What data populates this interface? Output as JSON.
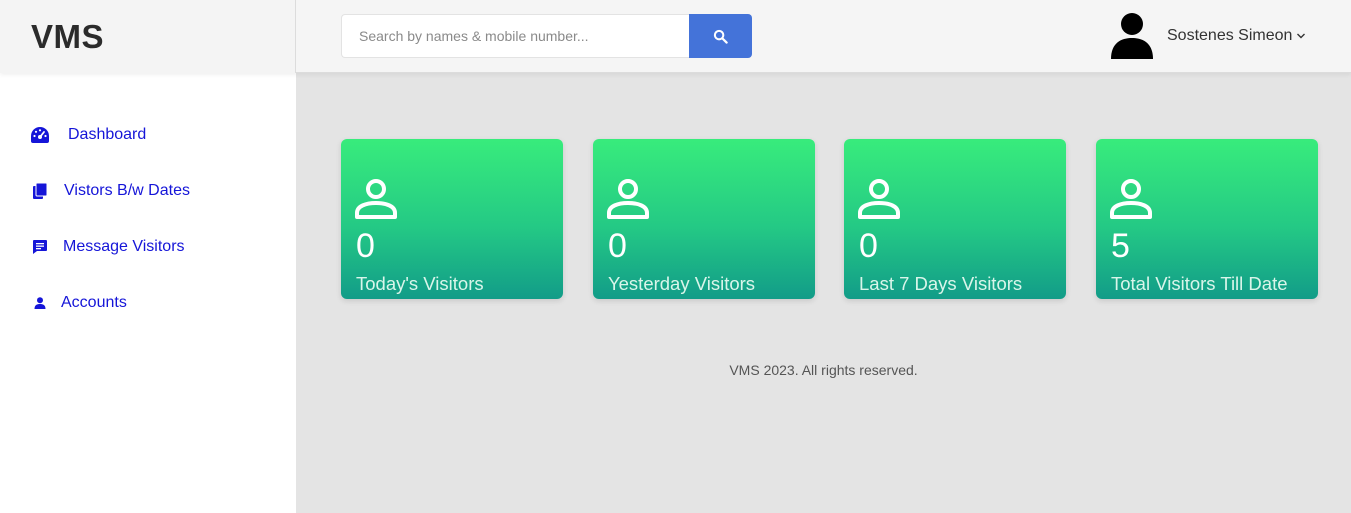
{
  "app": {
    "brand": "VMS"
  },
  "search": {
    "placeholder": "Search by names & mobile number..."
  },
  "user": {
    "name": "Sostenes Simeon"
  },
  "sidebar": {
    "items": [
      {
        "label": "Dashboard",
        "icon": "dashboard-gauge-icon"
      },
      {
        "label": "Vistors B/w Dates",
        "icon": "documents-icon"
      },
      {
        "label": "Message Visitors",
        "icon": "message-icon"
      },
      {
        "label": "Accounts",
        "icon": "person-icon"
      }
    ]
  },
  "cards": [
    {
      "count": "0",
      "label": "Today's Visitors"
    },
    {
      "count": "0",
      "label": "Yesterday Visitors"
    },
    {
      "count": "0",
      "label": "Last 7 Days Visitors"
    },
    {
      "count": "5",
      "label": "Total Visitors Till Date"
    }
  ],
  "footer": {
    "text": "VMS 2023. All rights reserved."
  },
  "colors": {
    "accent": "#4473d9",
    "nav_link": "#1515d8",
    "card_top": "#38ec7c",
    "card_bottom": "#129c88"
  }
}
